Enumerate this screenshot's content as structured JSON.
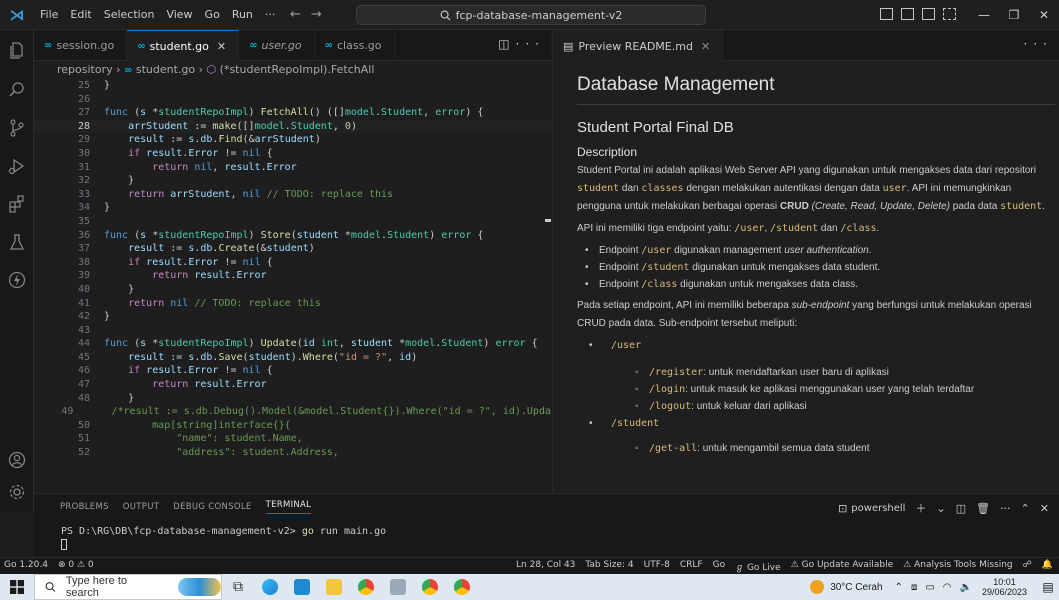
{
  "app": {
    "menu": [
      "File",
      "Edit",
      "Selection",
      "View",
      "Go",
      "Run",
      "···"
    ],
    "command_center": "fcp-database-management-v2"
  },
  "editor": {
    "tabs": [
      {
        "label": "session.go",
        "active": false,
        "italic": false
      },
      {
        "label": "student.go",
        "active": true,
        "italic": false
      },
      {
        "label": "user.go",
        "active": false,
        "italic": true
      },
      {
        "label": "class.go",
        "active": false,
        "italic": false
      }
    ],
    "breadcrumb": {
      "folder": "repository",
      "file": "student.go",
      "symbol": "(*studentRepoImpl).FetchAll"
    },
    "current_line": 28
  },
  "preview": {
    "tab_label": "Preview README.md",
    "h1": "Database Management",
    "h2": "Student Portal Final DB",
    "h3": "Description",
    "p1": {
      "a": "Student Portal ini adalah aplikasi Web Server API yang digunakan untuk mengakses data dari repositori ",
      "code1": "student",
      "b": " dan ",
      "code2": "classes",
      "c": " dengan melakukan autentikasi dengan data ",
      "code3": "user",
      "d": ". API ini memungkinkan pengguna untuk melakukan berbagai operasi ",
      "strong": "CRUD",
      "em": " (Create, Read, Update, Delete)",
      "e": " pada data ",
      "code4": "student",
      "f": "."
    },
    "p2": {
      "a": "API ini memiliki tiga endpoint yaitu: ",
      "c1": "/user",
      "s1": ", ",
      "c2": "/student",
      "s2": " dan ",
      "c3": "/class",
      "s3": "."
    },
    "bullets": [
      {
        "pre": "Endpoint ",
        "code": "/user",
        "post": " digunakan management ",
        "em": "user authentication",
        "end": "."
      },
      {
        "pre": "Endpoint ",
        "code": "/student",
        "post": " digunakan untuk mengakses data student.",
        "em": "",
        "end": ""
      },
      {
        "pre": "Endpoint ",
        "code": "/class",
        "post": " digunakan untuk mengakses data class.",
        "em": "",
        "end": ""
      }
    ],
    "p3": {
      "a": "Pada setiap endpoint, API ini memiliki beberapa ",
      "em": "sub-endpoint",
      "b": " yang berfungsi untuk melakukan operasi CRUD pada data. Sub-endpoint tersebut meliputi:"
    },
    "user_label": "/user",
    "user_sub": [
      {
        "code": "/register",
        "text": ": untuk mendaftarkan user baru di aplikasi"
      },
      {
        "code": "/login",
        "text": ": untuk masuk ke aplikasi menggunakan user yang telah terdaftar"
      },
      {
        "code": "/logout",
        "text": ": untuk keluar dari aplikasi"
      }
    ],
    "student_label": "/student",
    "student_sub": [
      {
        "code": "/get-all",
        "text": ": untuk mengambil semua data student"
      }
    ]
  },
  "panel": {
    "tabs": [
      "PROBLEMS",
      "OUTPUT",
      "DEBUG CONSOLE",
      "TERMINAL"
    ],
    "active_tab": "TERMINAL",
    "shell": "powershell",
    "prompt": "PS D:\\RG\\DB\\fcp-database-management-v2> ",
    "command_go": "go",
    "command_rest": " run main.go"
  },
  "statusbar": {
    "go_version": "Go 1.20.4",
    "problems": "⊗ 0 ⚠ 0",
    "position": "Ln 28, Col 43",
    "tab_size": "Tab Size: 4",
    "encoding": "UTF-8",
    "eol": "CRLF",
    "language": "Go",
    "go_live": "Go Live",
    "update": "Go Update Available",
    "analysis": "Analysis Tools Missing"
  },
  "taskbar": {
    "search_placeholder": "Type here to search",
    "weather": "30°C  Cerah",
    "time": "10:01",
    "date": "29/06/2023"
  },
  "colors": {
    "accent": "#0078d4",
    "keyword": "#569cd6",
    "control": "#c586c0",
    "function": "#dcdcaa",
    "type": "#4ec9b0",
    "variable": "#9cdcfe",
    "string": "#ce9178",
    "comment": "#6a9955",
    "inline_code": "#d7ba7d"
  }
}
